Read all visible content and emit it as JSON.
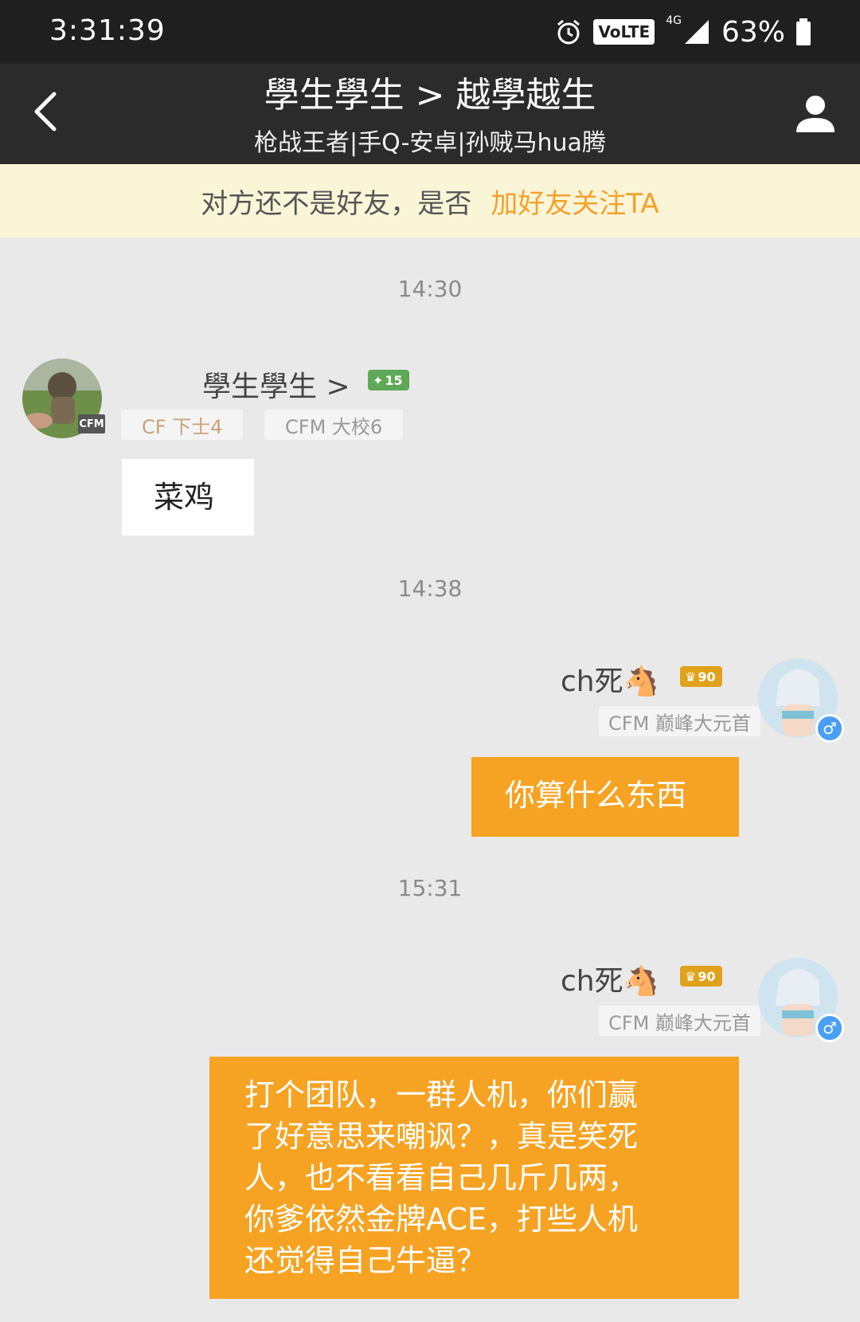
{
  "status_bar": {
    "time": "3:31:39",
    "volte": "VoLTE",
    "network": "4G",
    "battery": "63%"
  },
  "header": {
    "title": "學生學生 > 越學越生",
    "subtitle": "枪战王者|手Q-安卓|孙贼马hua腾"
  },
  "friend_banner": {
    "text": "对方还不是好友，是否",
    "action": "加好友关注TA"
  },
  "messages": [
    {
      "time": "14:30",
      "sender": {
        "name": "學生學生 >",
        "level": "15",
        "avatar_badge": "CFM",
        "tags": [
          "CF 下士4",
          "CFM 大校6"
        ]
      },
      "text": "菜鸡"
    },
    {
      "time": "14:38",
      "sender": {
        "name": "ch死🐴",
        "level": "90",
        "tags": [
          "CFM 巅峰大元首"
        ]
      },
      "text": "你算什么东西"
    },
    {
      "time": "15:31",
      "sender": {
        "name": "ch死🐴",
        "level": "90",
        "tags": [
          "CFM 巅峰大元首"
        ]
      },
      "text_lines": [
        "打个团队，一群人机，你们赢",
        "了好意思来嘲讽？，真是笑死",
        "人，也不看看自己几斤几两，",
        "你爹依然金牌ACE，打些人机",
        "还觉得自己牛逼？"
      ]
    }
  ],
  "colors": {
    "accent": "#f6a323",
    "banner_bg": "#fbf5d8",
    "nav_bg": "#2b2b2b",
    "chat_bg": "#e9e9e9"
  }
}
